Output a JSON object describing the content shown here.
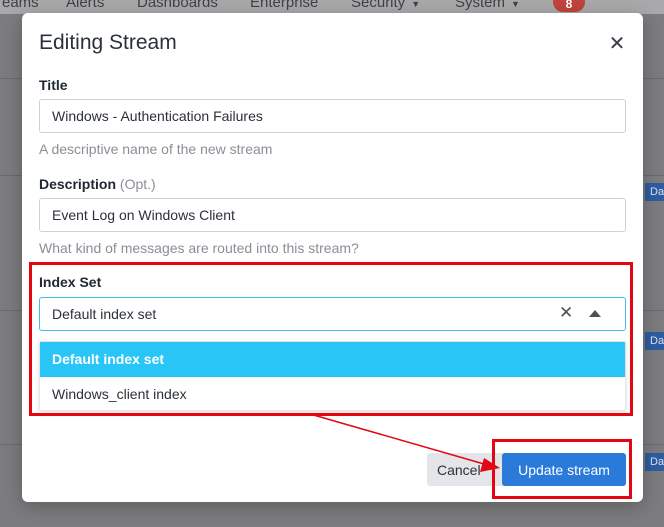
{
  "background": {
    "nav": [
      {
        "label": "eams"
      },
      {
        "label": "Alerts"
      },
      {
        "label": "Dashboards"
      },
      {
        "label": "Enterprise"
      },
      {
        "label": "Security",
        "has_caret": true
      },
      {
        "label": "System",
        "has_caret": true
      }
    ],
    "notification_count": "8",
    "row_tags": [
      "Da",
      "Da",
      "Da",
      "Da"
    ]
  },
  "modal": {
    "title": "Editing Stream",
    "close_icon": "close-icon",
    "title_field": {
      "label": "Title",
      "value": "Windows - Authentication Failures",
      "help": "A descriptive name of the new stream"
    },
    "description_field": {
      "label": "Description",
      "optional": "(Opt.)",
      "value": "Event Log on Windows Client",
      "help": "What kind of messages are routed into this stream?"
    },
    "index_set_field": {
      "label": "Index Set",
      "selected": "Default index set",
      "options": [
        "Default index set",
        "Windows_client index"
      ]
    },
    "buttons": {
      "cancel": "Cancel",
      "update": "Update stream"
    }
  },
  "colors": {
    "highlight": "#e30613",
    "primary": "#2a7bd9",
    "option_selected": "#29c5f6",
    "select_border": "#3fc0e6"
  }
}
